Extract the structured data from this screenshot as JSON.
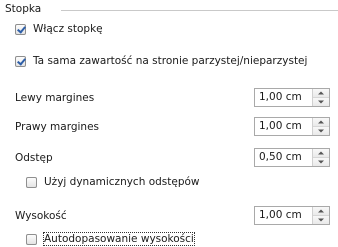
{
  "section": {
    "title": "Stopka"
  },
  "enable_footer": {
    "label": "Włącz stopkę",
    "checked": true
  },
  "same_content": {
    "label": "Ta sama zawartość na stronie parzystej/nieparzystej",
    "checked": true
  },
  "left_margin": {
    "label": "Lewy margines",
    "value": "1,00 cm"
  },
  "right_margin": {
    "label": "Prawy margines",
    "value": "1,00 cm"
  },
  "spacing": {
    "label": "Odstęp",
    "value": "0,50 cm"
  },
  "dynamic_spacing": {
    "label": "Użyj dynamicznych odstępów",
    "checked": false
  },
  "height": {
    "label": "Wysokość",
    "value": "1,00 cm"
  },
  "autofit": {
    "label": "Autodopasowanie wysokości",
    "checked": false
  }
}
